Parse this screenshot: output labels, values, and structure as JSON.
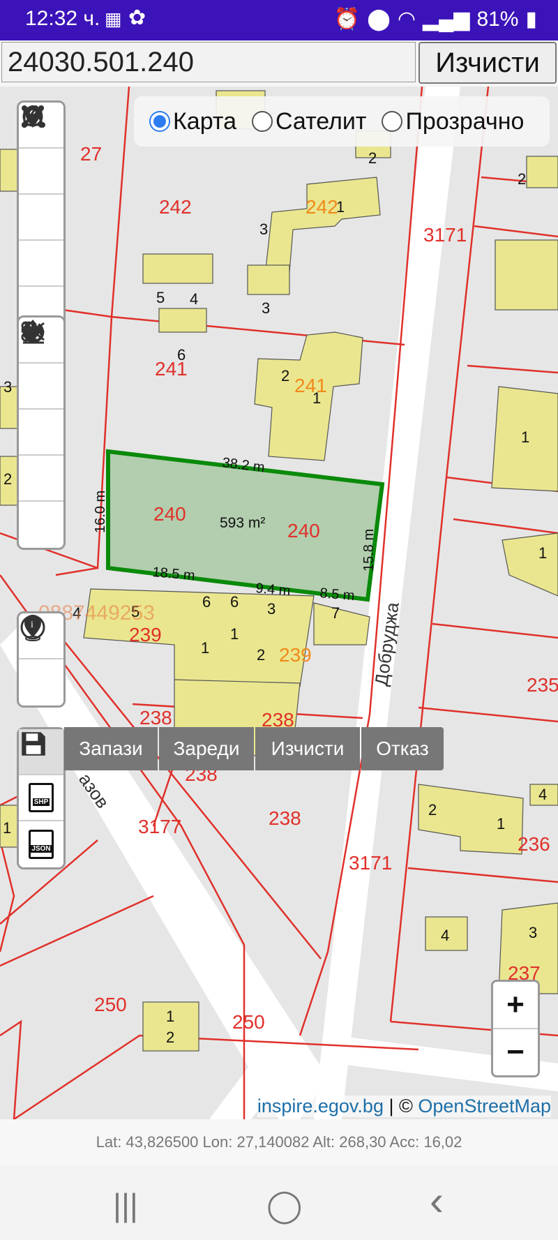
{
  "status": {
    "time": "12:32 ч.",
    "battery": "81%"
  },
  "search": {
    "value": "24030.501.240",
    "clear_label": "Изчисти"
  },
  "layers": {
    "options": [
      "Карта",
      "Сателит",
      "Прозрачно"
    ],
    "selected": "Карта"
  },
  "map_labels": {
    "parcels": [
      "27",
      "242",
      "3171",
      "241",
      "240",
      "239",
      "238",
      "3177",
      "250",
      "236",
      "235",
      "237"
    ],
    "buildings": [
      "2",
      "1",
      "3",
      "5",
      "4",
      "6",
      "7"
    ],
    "streets": [
      "Добруджа",
      "азов"
    ],
    "area": "593 m²",
    "dims": [
      "38.2 m",
      "16.0 m",
      "15.8 m",
      "18.5 m",
      "9.4 m",
      "8.5 m"
    ],
    "watermark": "0887449253"
  },
  "save_menu": {
    "save": "Запази",
    "load": "Зареди",
    "clear": "Изчисти",
    "cancel": "Отказ"
  },
  "export": {
    "shp": "SHP",
    "json": "JSON"
  },
  "zoom": {
    "in": "+",
    "out": "−"
  },
  "attribution": {
    "source": "inspire.egov.bg",
    "sep": " | © ",
    "osm": "OpenStreetMap"
  },
  "coords": "Lat: 43,826500 Lon: 27,140082 Alt: 268,30 Acc: 16,02",
  "nav": {
    "recent": "|||",
    "home": "◯",
    "back": "‹"
  }
}
